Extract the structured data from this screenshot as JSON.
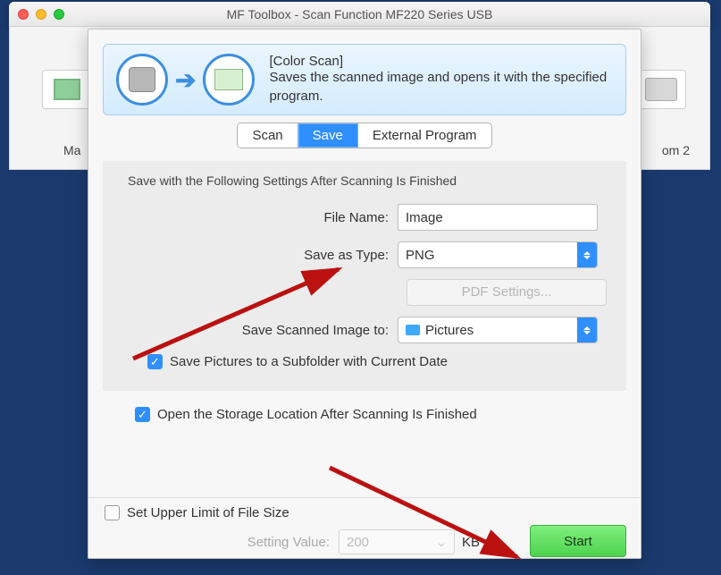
{
  "window": {
    "title": "MF Toolbox - Scan Function MF220 Series USB"
  },
  "back_row": {
    "left_label_fragment": "Ma",
    "right_label_fragment": "om 2"
  },
  "banner": {
    "title": "[Color Scan]",
    "description": "Saves the scanned image and opens it with the specified program."
  },
  "tabs": {
    "scan": "Scan",
    "save": "Save",
    "external": "External Program",
    "active": "save"
  },
  "panel": {
    "heading": "Save with the Following Settings After Scanning Is Finished",
    "file_name_label": "File Name:",
    "file_name_value": "Image",
    "save_as_type_label": "Save as Type:",
    "save_as_type_value": "PNG",
    "pdf_settings_label": "PDF Settings...",
    "save_to_label": "Save Scanned Image to:",
    "save_to_value": "Pictures",
    "subfolder_checkbox": "Save Pictures to a Subfolder with Current Date",
    "subfolder_checked": true
  },
  "open_location": {
    "label": "Open the Storage Location After Scanning Is Finished",
    "checked": true
  },
  "limit": {
    "label": "Set Upper Limit of File Size",
    "checked": false,
    "setting_value_label": "Setting Value:",
    "setting_value": "200",
    "unit": "KB"
  },
  "start_button": "Start"
}
